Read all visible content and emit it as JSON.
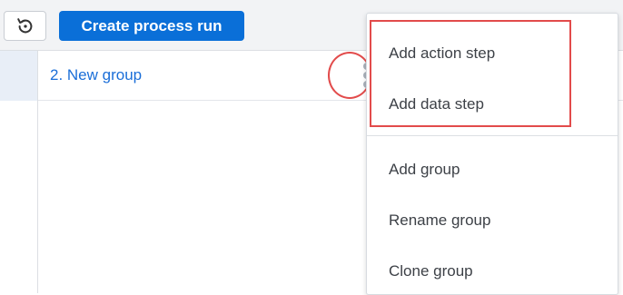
{
  "toolbar": {
    "history_icon": "history-refresh-icon",
    "create_label": "Create process run",
    "accent": "#0a6fd8"
  },
  "group": {
    "title": "2. New group",
    "menu_icon": "kebab-menu-icon"
  },
  "context_menu": {
    "items": [
      {
        "label": "Add action step"
      },
      {
        "label": "Add data step"
      },
      {
        "label": "Add group"
      },
      {
        "label": "Rename group"
      },
      {
        "label": "Clone group"
      }
    ]
  },
  "annotations": {
    "highlight_color": "#e24b4b"
  }
}
